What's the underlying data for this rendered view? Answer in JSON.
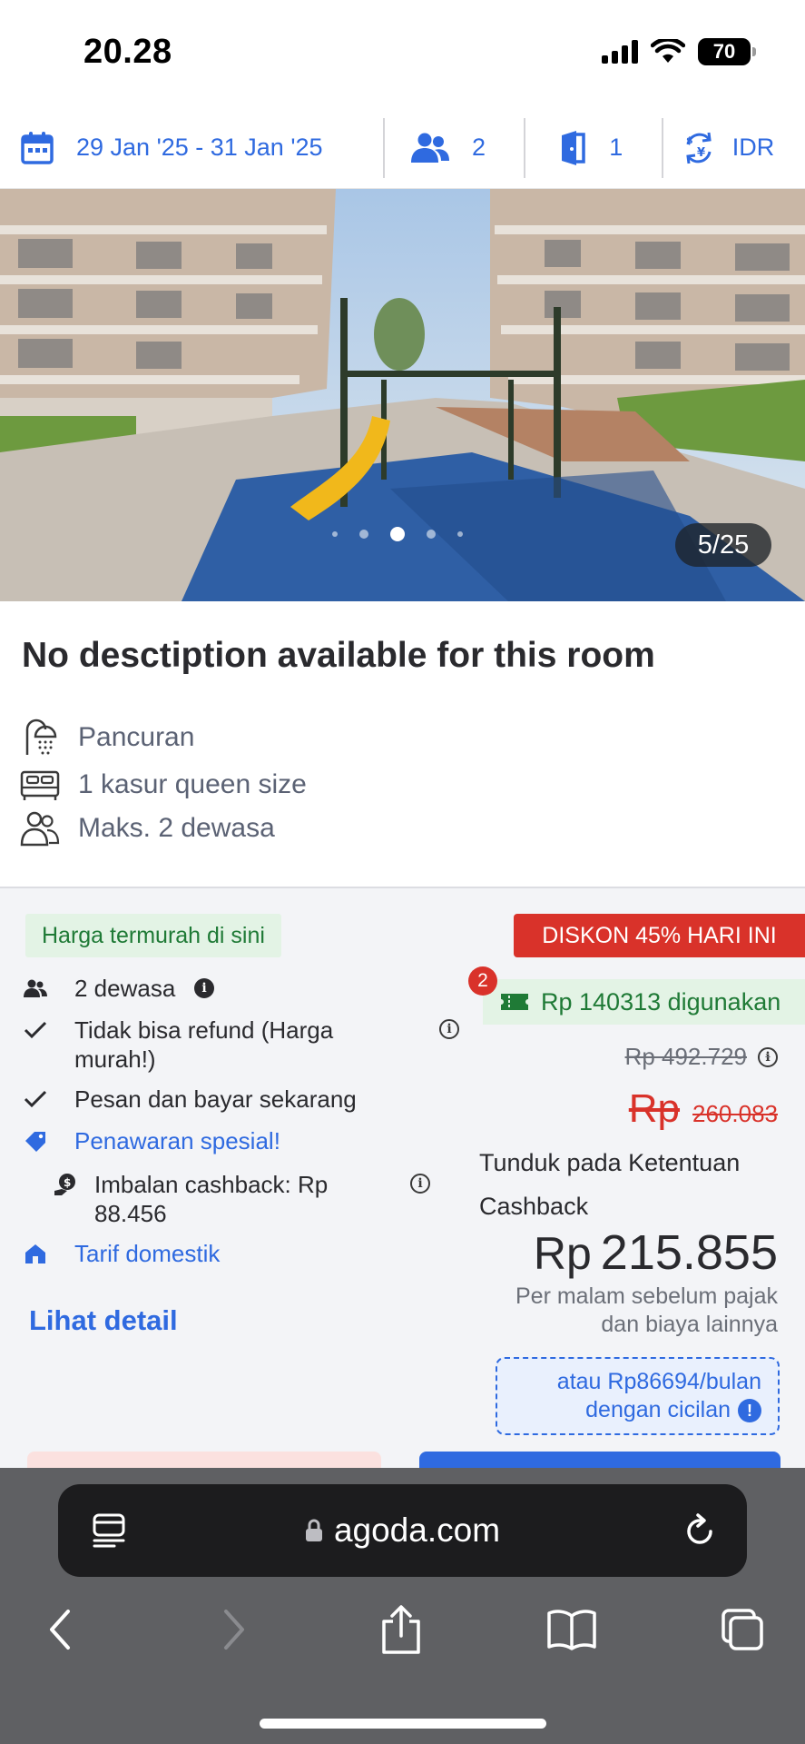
{
  "status_bar": {
    "time": "20.28",
    "battery": "70"
  },
  "search_summary": {
    "dates": "29 Jan '25 - 31 Jan '25",
    "guests": "2",
    "rooms": "1",
    "currency": "IDR"
  },
  "gallery": {
    "counter": "5/25"
  },
  "room": {
    "title": "No desctiption available for this room",
    "amenities": [
      {
        "icon": "shower-icon",
        "label": "Pancuran"
      },
      {
        "icon": "bed-icon",
        "label": "1 kasur queen size"
      },
      {
        "icon": "people-icon",
        "label": "Maks. 2 dewasa"
      }
    ]
  },
  "offer": {
    "cheapest_badge": "Harga termurah di sini",
    "discount_badge": "DISKON 45% HARI INI",
    "features": {
      "adults": "2 dewasa",
      "non_refundable_line1": "Tidak bisa refund (Harga",
      "non_refundable_line2": "murah!)",
      "pay_now": "Pesan dan bayar sekarang",
      "special_offer": "Penawaran spesial!",
      "cashback_line1": "Imbalan cashback: Rp",
      "cashback_line2": "88.456",
      "domestic_rate": "Tarif domestik"
    },
    "see_detail": "Lihat detail",
    "coupon_count": "2",
    "coupon_text": "Rp 140313 digunakan",
    "original_price": "Rp 492.729",
    "discounted_currency": "Rp",
    "discounted_price": "260.083",
    "cashback_terms_line1": "Tunduk pada Ketentuan",
    "cashback_terms_line2": "Cashback",
    "final_currency": "Rp",
    "final_price": "215.855",
    "per_night_line1": "Per malam sebelum pajak",
    "per_night_line2": "dan biaya lainnya",
    "installment_line1": "atau Rp86694/bulan",
    "installment_line2": "dengan cicilan"
  },
  "browser": {
    "url": "agoda.com"
  },
  "colors": {
    "accent": "#2f6ae0",
    "discount": "#d9322a",
    "success": "#1f7a36"
  }
}
